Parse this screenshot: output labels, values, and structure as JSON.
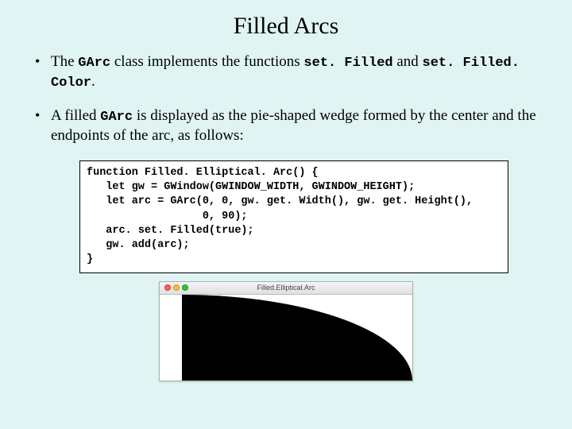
{
  "title": "Filled Arcs",
  "bullet1": {
    "t1": "The ",
    "c1": "GArc",
    "t2": " class implements the functions ",
    "c2": "set. Filled",
    "t3": " and ",
    "c3": "set. Filled. Color",
    "t4": "."
  },
  "bullet2": {
    "t1": "A filled ",
    "c1": "GArc",
    "t2": " is displayed as the pie-shaped wedge formed by the center and the endpoints of the arc, as follows:"
  },
  "code": "function Filled. Elliptical. Arc() {\n   let gw = GWindow(GWINDOW_WIDTH, GWINDOW_HEIGHT);\n   let arc = GArc(0, 0, gw. get. Width(), gw. get. Height(),\n                  0, 90);\n   arc. set. Filled(true);\n   gw. add(arc);\n}",
  "window": {
    "title": "Filled.Elliptical.Arc"
  },
  "colors": {
    "background": "#e0f4f4",
    "arc_fill": "#000000"
  }
}
